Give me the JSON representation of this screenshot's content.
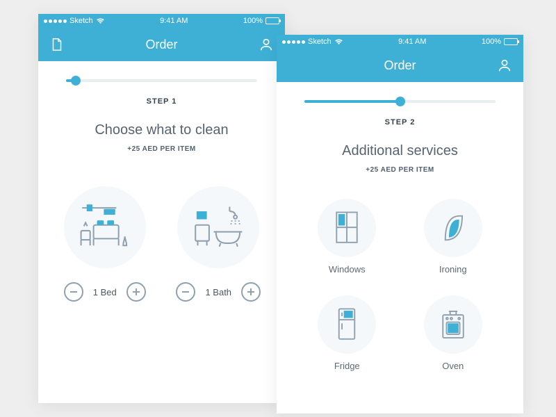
{
  "status": {
    "carrier": "Sketch",
    "time": "9:41 AM",
    "battery": "100%"
  },
  "screen1": {
    "nav_title": "Order",
    "step_label": "STEP 1",
    "headline": "Choose what to clean",
    "subline": "+25 AED PER ITEM",
    "items": [
      {
        "id": "bed",
        "count_label": "1 Bed"
      },
      {
        "id": "bath",
        "count_label": "1 Bath"
      }
    ],
    "progress": {
      "fill_pct": 5,
      "knob_pct": 5
    }
  },
  "screen2": {
    "nav_title": "Order",
    "step_label": "STEP 2",
    "headline": "Additional services",
    "subline": "+25 AED PER ITEM",
    "services": [
      {
        "label": "Windows"
      },
      {
        "label": "Ironing"
      },
      {
        "label": "Fridge"
      },
      {
        "label": "Oven"
      }
    ],
    "progress": {
      "fill_pct": 50,
      "knob_pct": 50
    }
  },
  "colors": {
    "brand": "#3eb0d6"
  }
}
